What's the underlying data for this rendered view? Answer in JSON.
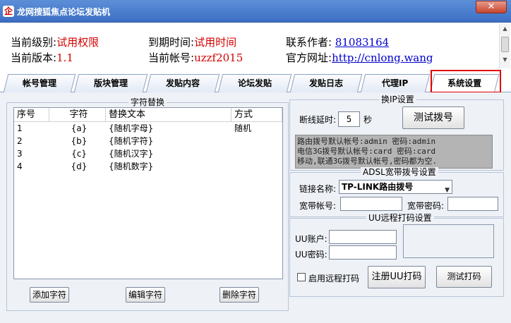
{
  "window": {
    "title": "龙网搜狐焦点论坛发贴机",
    "app_icon_glyph": "企",
    "close_glyph": "✕"
  },
  "info": {
    "level_label": "当前级别:",
    "level_value": "试用权限",
    "expire_label": "到期时间:",
    "expire_value": "试用时间",
    "author_label": "联系作者: ",
    "author_value": "81083164",
    "version_label": "当前版本:",
    "version_value": "1.1",
    "account_label": "当前帐号:",
    "account_value": "uzzf2015",
    "site_label": "官方网址:",
    "site_value": "http://cnlong.wang"
  },
  "tabs": [
    "帐号管理",
    "版块管理",
    "发贴内容",
    "论坛发贴",
    "发贴日志",
    "代理IP",
    "系统设置"
  ],
  "active_tab": "系统设置",
  "char_replace": {
    "title": "字符替换",
    "columns": [
      "序号",
      "字符",
      "替换文本",
      "方式"
    ],
    "rows": [
      {
        "no": "1",
        "char": "{a}",
        "text": "{随机字母}",
        "mode": "随机"
      },
      {
        "no": "2",
        "char": "{b}",
        "text": "{随机字符}",
        "mode": ""
      },
      {
        "no": "3",
        "char": "{c}",
        "text": "{随机汉字}",
        "mode": ""
      },
      {
        "no": "4",
        "char": "{d}",
        "text": "{随机数字}",
        "mode": ""
      }
    ],
    "add_button": "添加字符",
    "edit_button": "编辑字符",
    "delete_button": "删除字符"
  },
  "ip_switch": {
    "title": "换IP设置",
    "delay_label": "断线延时:",
    "delay_value": "5",
    "delay_unit": "秒",
    "test_dial_button": "测试拨号",
    "note_lines": [
      "路由拨号默认帐号:admin 密码:admin",
      "电信3G拨号默认帐号:card 密码:card",
      "移动,联通3G拨号默认帐号,密码都为空."
    ]
  },
  "adsl": {
    "title": "ADSL宽带拨号设置",
    "link_label": "链接名称:",
    "link_value": "TP-LINK路由拨号",
    "account_label": "宽带帐号:",
    "account_value": "",
    "password_label": "宽带密码:",
    "password_value": ""
  },
  "uu": {
    "title": "UU远程打码设置",
    "account_label": "UU账户:",
    "account_value": "",
    "password_label": "UU密码:",
    "password_value": "",
    "enable_label": "启用远程打码",
    "register_button": "注册UU打码",
    "test_button": "测试打码"
  },
  "colors": {
    "accent_red": "#d40000",
    "title_bar": "#3b6fc4",
    "link_blue": "#0000cc"
  }
}
